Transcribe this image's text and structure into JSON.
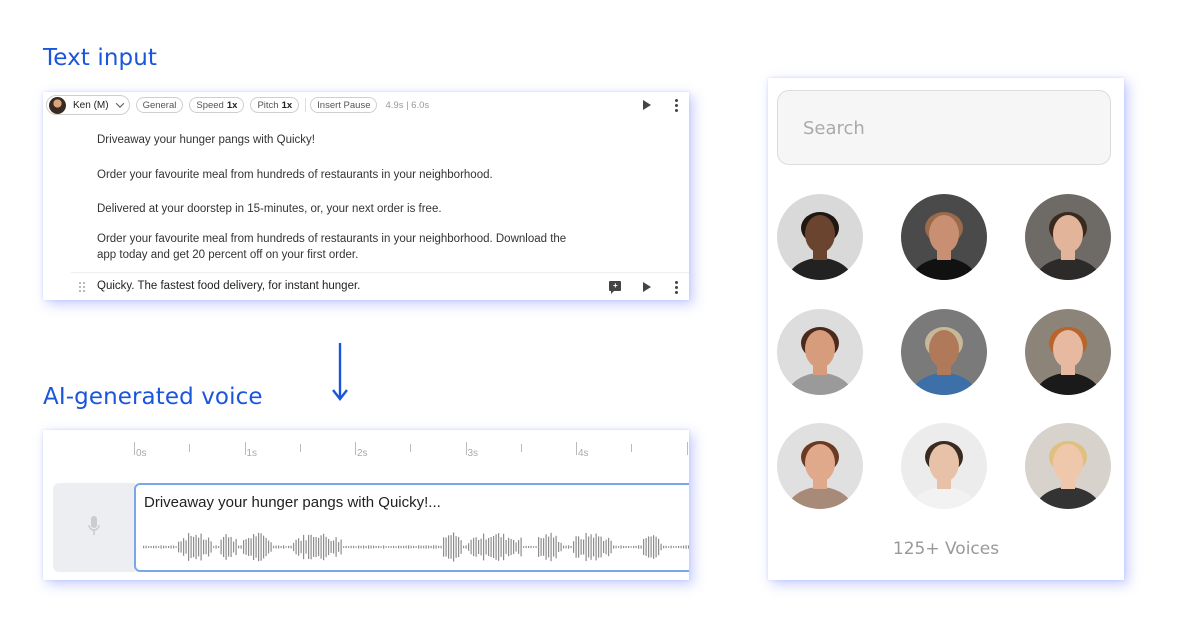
{
  "headings": {
    "text_input": "Text input",
    "ai_voice": "AI-generated voice"
  },
  "editor": {
    "voice_name": "Ken (M)",
    "chips": {
      "general": "General",
      "speed_label": "Speed",
      "speed_value": "1x",
      "pitch_label": "Pitch",
      "pitch_value": "1x",
      "insert_pause": "Insert Pause"
    },
    "duration": "4.9s | 6.0s",
    "paragraphs": [
      "Driveaway your hunger pangs with Quicky!",
      "Order your favourite meal from hundreds of restaurants in your neighborhood.",
      "Delivered at your doorstep in 15-minutes, or, your next order is free.",
      "Order your favourite meal from hundreds of restaurants in your neighborhood. Download the app today and get 20 percent off on your first order."
    ],
    "active_row": "Quicky. The fastest food delivery, for instant hunger."
  },
  "timeline": {
    "ticks": [
      "0s",
      "1s",
      "2s",
      "3s",
      "4s"
    ],
    "clip_title": "Driveaway your hunger pangs with Quicky!..."
  },
  "voices_panel": {
    "search_placeholder": "Search",
    "count_label": "125+ Voices",
    "avatars": [
      {
        "bg": "#d9d9d9",
        "skin": "#6b4430",
        "hair": "#1e1712",
        "shirt": "#222222"
      },
      {
        "bg": "#4a4a4a",
        "skin": "#c98f73",
        "hair": "#9a6a4a",
        "shirt": "#111111"
      },
      {
        "bg": "#6e6a66",
        "skin": "#e2b59a",
        "hair": "#3a2a1e",
        "shirt": "#2d2b2a"
      },
      {
        "bg": "#dddddd",
        "skin": "#d79c7c",
        "hair": "#4a2a1c",
        "shirt": "#9a9a9a"
      },
      {
        "bg": "#7a7a7a",
        "skin": "#b07a5a",
        "hair": "#c8b89a",
        "shirt": "#3d6fa8"
      },
      {
        "bg": "#8c8478",
        "skin": "#e6b9a0",
        "hair": "#b8642a",
        "shirt": "#1a1a1a"
      },
      {
        "bg": "#e0e0e0",
        "skin": "#e0a98c",
        "hair": "#6a3a22",
        "shirt": "#a88a78"
      },
      {
        "bg": "#ececec",
        "skin": "#e8c2a8",
        "hair": "#3a2a22",
        "shirt": "#f2f2f2"
      },
      {
        "bg": "#d7d2cc",
        "skin": "#efc8ac",
        "hair": "#e0c080",
        "shirt": "#333333"
      }
    ]
  },
  "colors": {
    "accent": "#1a56db",
    "clip_border": "#7aa7e8"
  }
}
